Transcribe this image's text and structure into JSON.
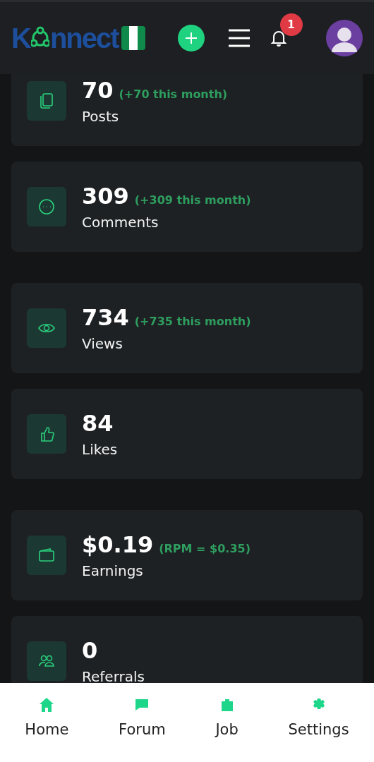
{
  "header": {
    "logo_start": "K",
    "logo_end": "nnect",
    "notification_count": "1"
  },
  "stats": [
    {
      "kind": "posts",
      "value": "70",
      "note": "(+70 this month)",
      "label": "Posts"
    },
    {
      "kind": "comments",
      "value": "309",
      "note": "(+309 this month)",
      "label": "Comments"
    },
    {
      "kind": "views",
      "value": "734",
      "note": "(+735 this month)",
      "label": "Views"
    },
    {
      "kind": "likes",
      "value": "84",
      "label": "Likes"
    },
    {
      "kind": "earnings",
      "value": "$0.19",
      "note": "(RPM = $0.35)",
      "label": "Earnings"
    },
    {
      "kind": "referrals",
      "value": "0",
      "label": "Referrals"
    }
  ],
  "bottom_nav": [
    {
      "kind": "home",
      "label": "Home"
    },
    {
      "kind": "forum",
      "label": "Forum"
    },
    {
      "kind": "job",
      "label": "Job"
    },
    {
      "kind": "settings",
      "label": "Settings"
    }
  ]
}
